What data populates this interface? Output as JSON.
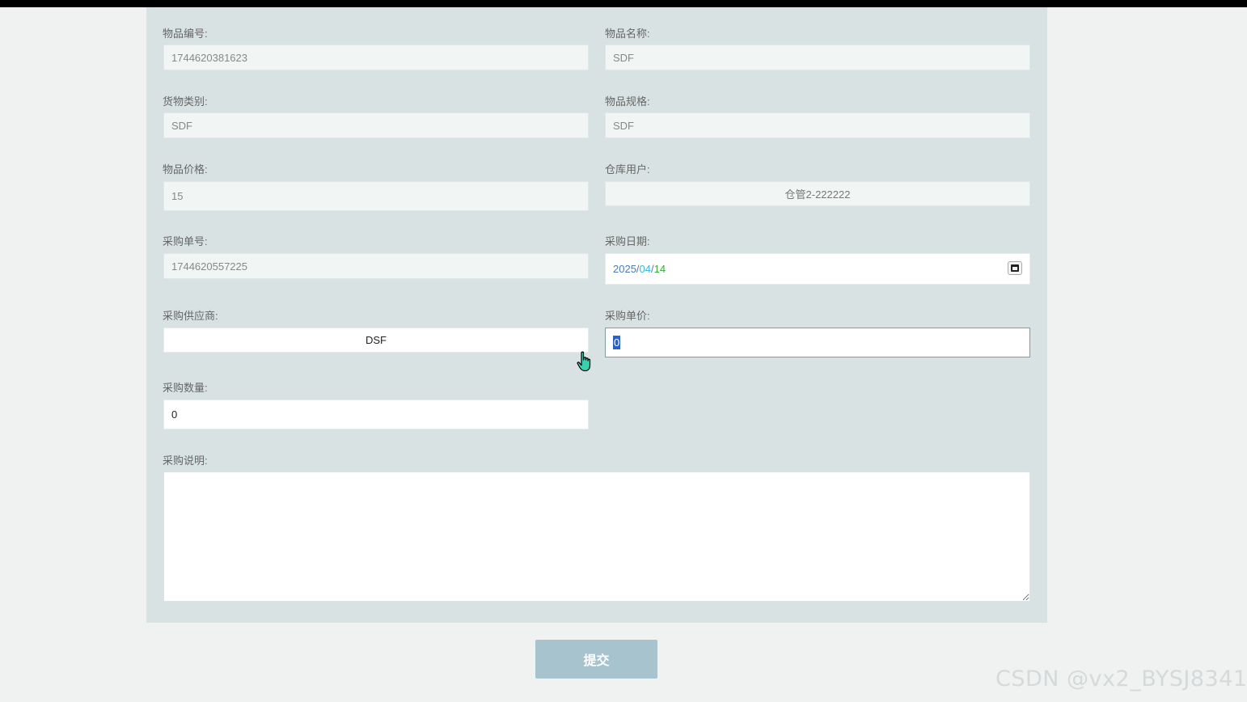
{
  "form": {
    "item_no": {
      "label": "物品编号:",
      "value": "1744620381623"
    },
    "item_name": {
      "label": "物品名称:",
      "value": "SDF"
    },
    "category": {
      "label": "货物类别:",
      "value": "SDF"
    },
    "spec": {
      "label": "物品规格:",
      "value": "SDF"
    },
    "price": {
      "label": "物品价格:",
      "value": "15"
    },
    "warehouse_user": {
      "label": "仓库用户:",
      "value": "仓管2-222222"
    },
    "purchase_no": {
      "label": "采购单号:",
      "value": "1744620557225"
    },
    "purchase_date": {
      "label": "采购日期:",
      "year": "2025",
      "month": "04",
      "day": "14",
      "sep": "/"
    },
    "supplier": {
      "label": "采购供应商:",
      "value": "DSF"
    },
    "unit_price": {
      "label": "采购单价:",
      "value": "0"
    },
    "quantity": {
      "label": "采购数量:",
      "value": "0"
    },
    "description": {
      "label": "采购说明:",
      "value": ""
    }
  },
  "submit_label": "提交",
  "watermark": "CSDN @vx2_BYSJ8341",
  "icons": {
    "calendar": "calendar-icon",
    "cursor": "hand-pointer-icon"
  },
  "colors": {
    "panel": "#d8e2e2",
    "page": "#f0f2f1",
    "button": "#a6c3ce"
  }
}
